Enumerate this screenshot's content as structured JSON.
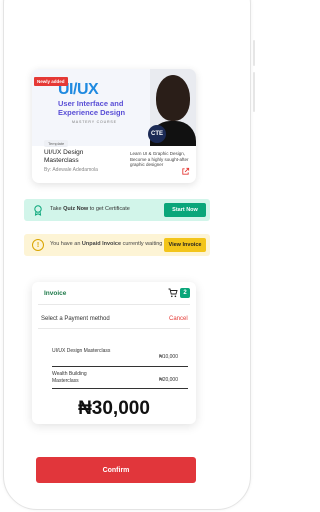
{
  "course": {
    "ribbon": "Newly added",
    "banner_title": "UI/UX",
    "banner_subtitle": "User Interface and Experience Design",
    "banner_small": "MASTERY COURSE",
    "badge": "CTE",
    "tag": "Template",
    "name": "UI/UX Design Masterclass",
    "author": "By: Adewale Adedamola",
    "description": "Learn UI & Graphic Design, Become a highly sought-after graphic designer"
  },
  "quiz": {
    "text_prefix": "Take",
    "text_bold": "Quiz Now",
    "text_suffix": "to get Certificate",
    "button": "Start Now"
  },
  "invoice_notice": {
    "text_prefix": "You have an",
    "text_bold": "Unpaid Invoice",
    "text_suffix": "currently waiting",
    "button": "View Invoice"
  },
  "invoice": {
    "title": "Invoice",
    "cart_count": "2",
    "select_label": "Select a Payment method",
    "cancel": "Cancel",
    "items": [
      {
        "name": "UI/UX Design Masterclass",
        "price": "₦10,000"
      },
      {
        "name": "Wealth Building Masterclass",
        "price": "₦20,000"
      }
    ],
    "total": "₦30,000"
  },
  "confirm": "Confirm",
  "colors": {
    "accent_green": "#0aa67a",
    "danger_red": "#e1363b",
    "warning_yellow": "#f3c51a"
  }
}
